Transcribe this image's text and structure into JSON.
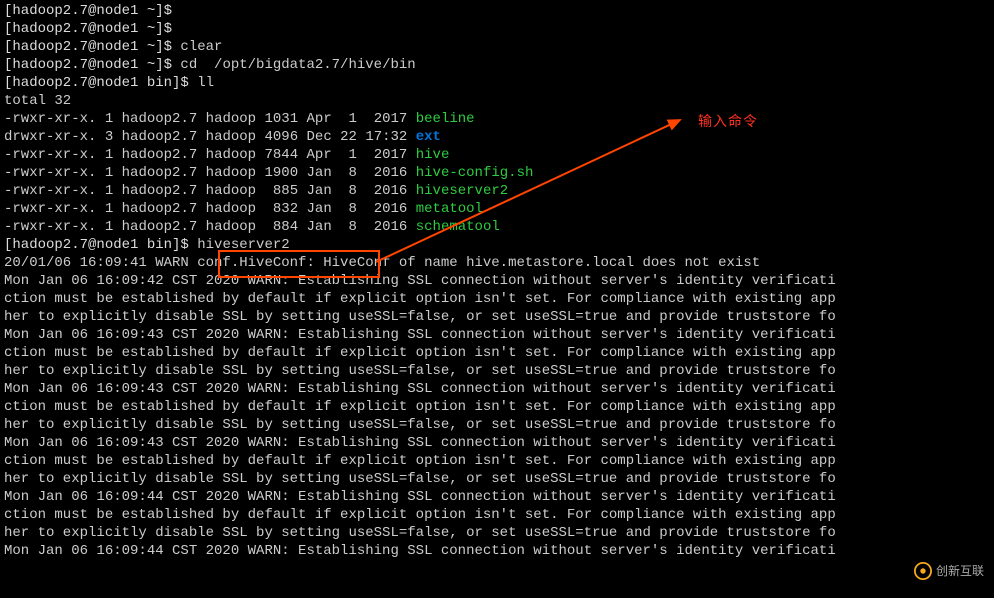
{
  "prompt_user_host": "[hadoop2.7@node1 ~]$",
  "prompt_bin": "[hadoop2.7@node1 bin]$",
  "cmds": {
    "empty": " ",
    "clear": " clear",
    "cd": " cd  /opt/bigdata2.7/hive/bin",
    "ll": " ll",
    "hs2": " hiveserver2"
  },
  "total_line": "total 32",
  "ls": [
    {
      "perm": "-rwxr-xr-x.",
      "lnk": "1",
      "own": "hadoop2.7",
      "grp": "hadoop",
      "size": "1031",
      "date": "Apr  1  2017",
      "name": "beeline",
      "cls": "green"
    },
    {
      "perm": "drwxr-xr-x.",
      "lnk": "3",
      "own": "hadoop2.7",
      "grp": "hadoop",
      "size": "4096",
      "date": "Dec 22 17:32",
      "name": "ext",
      "cls": "blue"
    },
    {
      "perm": "-rwxr-xr-x.",
      "lnk": "1",
      "own": "hadoop2.7",
      "grp": "hadoop",
      "size": "7844",
      "date": "Apr  1  2017",
      "name": "hive",
      "cls": "green"
    },
    {
      "perm": "-rwxr-xr-x.",
      "lnk": "1",
      "own": "hadoop2.7",
      "grp": "hadoop",
      "size": "1900",
      "date": "Jan  8  2016",
      "name": "hive-config.sh",
      "cls": "green"
    },
    {
      "perm": "-rwxr-xr-x.",
      "lnk": "1",
      "own": "hadoop2.7",
      "grp": "hadoop",
      "size": " 885",
      "date": "Jan  8  2016",
      "name": "hiveserver2",
      "cls": "green"
    },
    {
      "perm": "-rwxr-xr-x.",
      "lnk": "1",
      "own": "hadoop2.7",
      "grp": "hadoop",
      "size": " 832",
      "date": "Jan  8  2016",
      "name": "metatool",
      "cls": "green"
    },
    {
      "perm": "-rwxr-xr-x.",
      "lnk": "1",
      "own": "hadoop2.7",
      "grp": "hadoop",
      "size": " 884",
      "date": "Jan  8  2016",
      "name": "schematool",
      "cls": "green"
    }
  ],
  "annotation": "输入命令",
  "log_head": "20/01/06 16:09:41 WARN conf.HiveConf: HiveConf of name hive.metastore.local does not exist",
  "warn_para": "ction must be established by default if explicit option isn't set. For compliance with existing app\nher to explicitly disable SSL by setting useSSL=false, or set useSSL=true and provide truststore fo",
  "warns": [
    "Mon Jan 06 16:09:42 CST 2020 WARN: Establishing SSL connection without server's identity verificati",
    "Mon Jan 06 16:09:43 CST 2020 WARN: Establishing SSL connection without server's identity verificati",
    "Mon Jan 06 16:09:43 CST 2020 WARN: Establishing SSL connection without server's identity verificati",
    "Mon Jan 06 16:09:43 CST 2020 WARN: Establishing SSL connection without server's identity verificati",
    "Mon Jan 06 16:09:44 CST 2020 WARN: Establishing SSL connection without server's identity verificati",
    "Mon Jan 06 16:09:44 CST 2020 WARN: Establishing SSL connection without server's identity verificati"
  ],
  "watermark": "创新互联"
}
